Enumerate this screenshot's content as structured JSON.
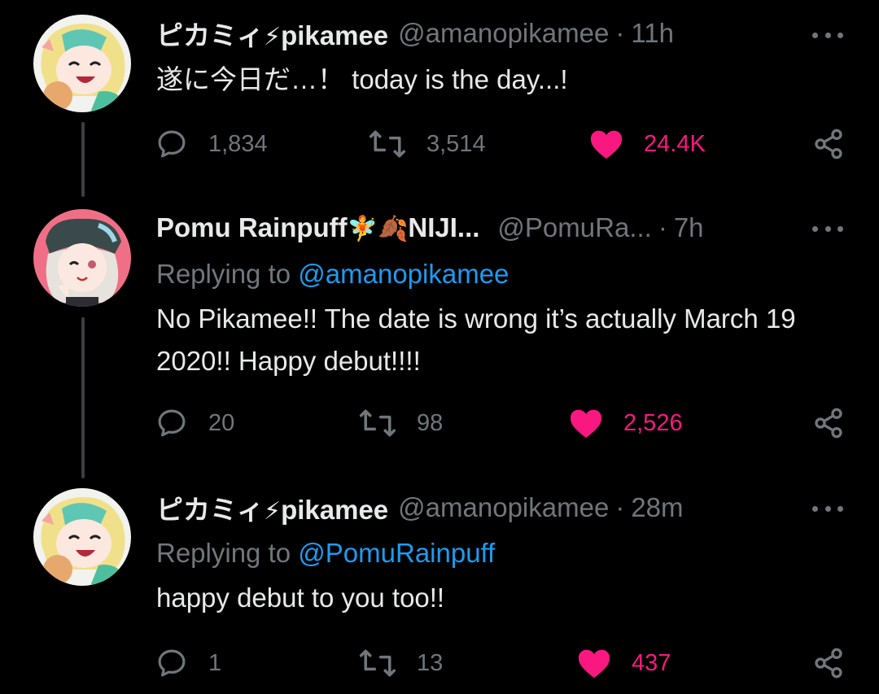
{
  "tweets": [
    {
      "display_name": "ピカミィ",
      "name_suffix": "pikamee",
      "name_emoji": "⚡",
      "handle": "@amanopikamee",
      "separator": "·",
      "time": "11h",
      "replying_label": "",
      "replying_to": "",
      "text": "遂に今日だ…！ today is the day...!",
      "replies": "1,834",
      "retweets": "3,514",
      "likes": "24.4K",
      "liked": true
    },
    {
      "display_name": "Pomu Rainpuff",
      "name_emoji": "🧚🍂",
      "name_suffix": "NIJI...",
      "handle": "@PomuRa...",
      "separator": "·",
      "time": "7h",
      "replying_label": "Replying to",
      "replying_to": "@amanopikamee",
      "text": "No Pikamee!! The date is wrong it’s actually March 19 2020!! Happy debut!!!!",
      "replies": "20",
      "retweets": "98",
      "likes": "2,526",
      "liked": true
    },
    {
      "display_name": "ピカミィ",
      "name_suffix": "pikamee",
      "name_emoji": "⚡",
      "handle": "@amanopikamee",
      "separator": "·",
      "time": "28m",
      "replying_label": "Replying to",
      "replying_to": "@PomuRainpuff",
      "text": "happy debut to you too!!",
      "replies": "1",
      "retweets": "13",
      "likes": "437",
      "liked": true
    }
  ],
  "icons": {
    "reply": "reply-bubble-icon",
    "retweet": "retweet-icon",
    "like": "heart-icon",
    "share": "share-icon",
    "more": "more-dots-icon"
  },
  "colors": {
    "background": "#000000",
    "text": "#e7e9ea",
    "muted": "#71767b",
    "link": "#1d9bf0",
    "like": "#f91880"
  }
}
